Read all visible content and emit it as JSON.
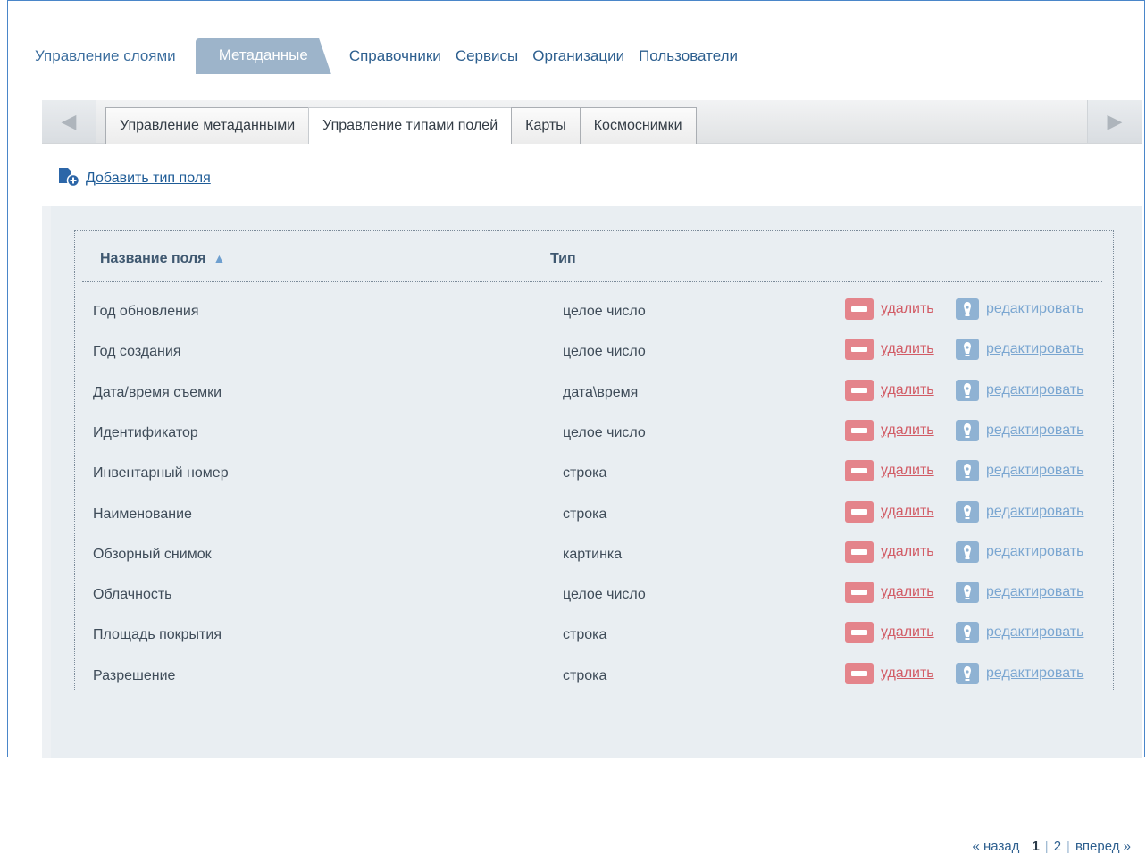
{
  "topnav": {
    "items": [
      "Управление слоями",
      "Метаданные",
      "Справочники",
      "Сервисы",
      "Организации",
      "Пользователи"
    ],
    "active_index": 1
  },
  "subtabs": {
    "items": [
      "Управление метаданными",
      "Управление типами полей",
      "Карты",
      "Космоснимки"
    ],
    "active_index": 1,
    "prev_icon": "triangle-left-icon",
    "next_icon": "triangle-right-icon"
  },
  "add_link": {
    "label": "Добавить тип поля",
    "icon": "add-document-icon"
  },
  "table": {
    "headers": {
      "name": "Название поля",
      "type": "Тип"
    },
    "sort_icon": "▲",
    "rows": [
      {
        "name": "Год обновления",
        "type": "целое число"
      },
      {
        "name": "Год создания",
        "type": "целое число"
      },
      {
        "name": "Дата/время съемки",
        "type": "дата\\время"
      },
      {
        "name": "Идентификатор",
        "type": "целое число"
      },
      {
        "name": "Инвентарный номер",
        "type": "строка"
      },
      {
        "name": "Наименование",
        "type": "строка"
      },
      {
        "name": "Обзорный снимок",
        "type": "картинка"
      },
      {
        "name": "Облачность",
        "type": "целое число"
      },
      {
        "name": "Площадь покрытия",
        "type": "строка"
      },
      {
        "name": "Разрешение",
        "type": "строка"
      }
    ],
    "delete_label": "удалить",
    "edit_label": "редактировать"
  },
  "pager": {
    "prev": "« назад",
    "pages": [
      "1",
      "2"
    ],
    "current": "1",
    "next": "вперед »"
  },
  "colors": {
    "accent": "#1f5c97",
    "tab_active": "#9db4ca",
    "delete": "#e4848b",
    "edit": "#8fb2d3"
  }
}
